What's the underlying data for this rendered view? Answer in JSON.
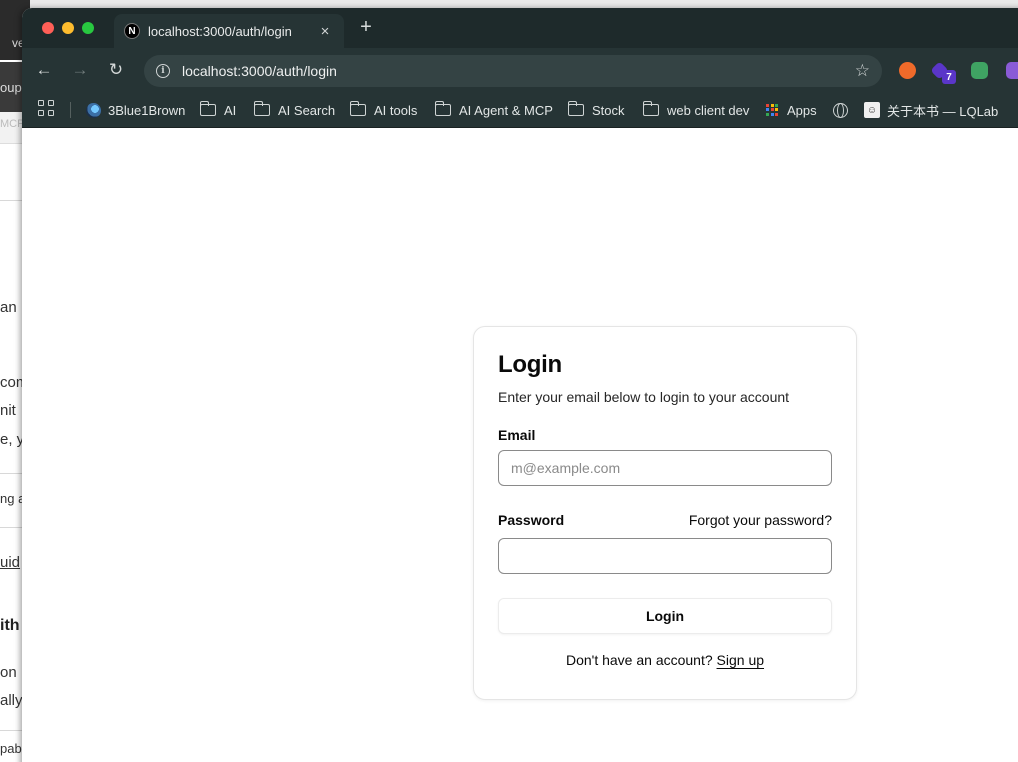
{
  "background_window": {
    "fragments": [
      "ve",
      "oup",
      "MCP",
      "an",
      "com",
      "nit",
      "e, y",
      "ng a",
      "uid",
      "ith",
      "on",
      "ally",
      "pab"
    ]
  },
  "browser": {
    "tab": {
      "title": "localhost:3000/auth/login",
      "favicon": "N",
      "close_label": "×"
    },
    "new_tab_label": "+",
    "nav": {
      "back": "←",
      "forward": "→",
      "reload": "↻"
    },
    "omnibox": {
      "url": "localhost:3000/auth/login",
      "info_icon": "i",
      "star_icon": "☆"
    },
    "extensions": {
      "badge_count": "7"
    },
    "bookmarks": [
      {
        "label": "3Blue1Brown",
        "icon": "3b1b-icon"
      },
      {
        "label": "AI",
        "icon": "folder-icon"
      },
      {
        "label": "AI Search",
        "icon": "folder-icon"
      },
      {
        "label": "AI tools",
        "icon": "folder-icon"
      },
      {
        "label": "AI Agent & MCP",
        "icon": "folder-icon"
      },
      {
        "label": "Stock",
        "icon": "folder-icon"
      },
      {
        "label": "web client dev",
        "icon": "folder-icon"
      },
      {
        "label": "Apps",
        "icon": "apps-grid-icon"
      },
      {
        "label": "",
        "icon": "globe-icon"
      },
      {
        "label": "关于本书 — LQLab",
        "icon": "face-icon"
      }
    ]
  },
  "login": {
    "title": "Login",
    "description": "Enter your email below to login to your account",
    "email_label": "Email",
    "email_placeholder": "m@example.com",
    "email_value": "",
    "password_label": "Password",
    "forgot_label": "Forgot your password?",
    "password_value": "",
    "submit_label": "Login",
    "signup_prompt": "Don't have an account?",
    "signup_link": "Sign up"
  },
  "colors": {
    "titlebar": "#1e2a2b",
    "toolbar": "#263435",
    "omnibox": "#344344",
    "card_border": "#e5e5e5",
    "text": "#0a0a0a"
  }
}
